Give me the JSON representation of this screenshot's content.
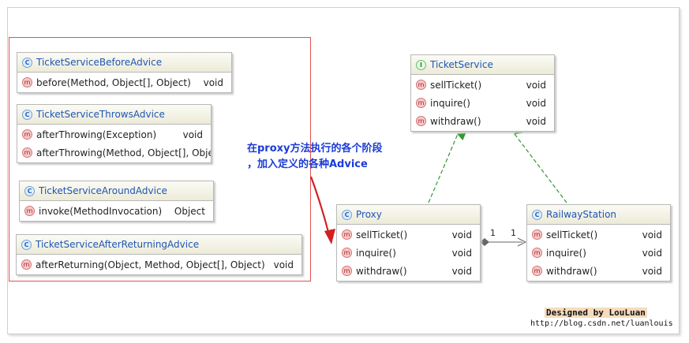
{
  "note": {
    "line1": "在proxy方法执行的各个阶段",
    "line2": "，加入定义的各种Advice"
  },
  "credit": {
    "designed_by": "Designed by LouLuan",
    "url": "http://blog.csdn.net/luanlouis"
  },
  "advices": [
    {
      "name": "TicketServiceBeforeAdvice",
      "methods": [
        {
          "sig": "before(Method, Object[], Object)",
          "ret": "void"
        }
      ]
    },
    {
      "name": "TicketServiceThrowsAdvice",
      "methods": [
        {
          "sig": "afterThrowing(Exception)",
          "ret": "void"
        },
        {
          "sig": "afterThrowing(Method, Object[], Object",
          "ret": ""
        }
      ]
    },
    {
      "name": "TicketServiceAroundAdvice",
      "methods": [
        {
          "sig": "invoke(MethodInvocation)",
          "ret": "Object"
        }
      ]
    },
    {
      "name": "TicketServiceAfterReturningAdvice",
      "methods": [
        {
          "sig": "afterReturning(Object, Method, Object[], Object)",
          "ret": "void"
        }
      ]
    }
  ],
  "ticket_service": {
    "name": "TicketService",
    "methods": [
      {
        "sig": "sellTicket()",
        "ret": "void"
      },
      {
        "sig": "inquire()",
        "ret": "void"
      },
      {
        "sig": "withdraw()",
        "ret": "void"
      }
    ]
  },
  "proxy": {
    "name": "Proxy",
    "methods": [
      {
        "sig": "sellTicket()",
        "ret": "void"
      },
      {
        "sig": "inquire()",
        "ret": "void"
      },
      {
        "sig": "withdraw()",
        "ret": "void"
      }
    ]
  },
  "railway_station": {
    "name": "RailwayStation",
    "methods": [
      {
        "sig": "sellTicket()",
        "ret": "void"
      },
      {
        "sig": "inquire()",
        "ret": "void"
      },
      {
        "sig": "withdraw()",
        "ret": "void"
      }
    ]
  },
  "association": {
    "source_multiplicity": "1",
    "target_multiplicity": "1"
  },
  "badges": {
    "class": "C",
    "interface": "I",
    "method": "m"
  },
  "colors": {
    "advice_group_border": "#e05050",
    "note_text": "#1a3bd6",
    "realization_line": "#2f9a2f",
    "note_arrow": "#d22020"
  }
}
